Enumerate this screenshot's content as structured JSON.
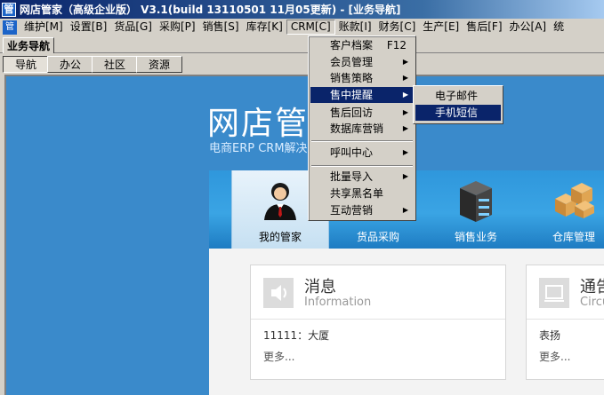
{
  "window": {
    "title": "网店管家（高级企业版） V3.1(build 13110501 11月05更新) - [业务导航]",
    "icon_char": "管"
  },
  "menubar": {
    "icon_char": "管",
    "items": [
      {
        "label": "维护[M]"
      },
      {
        "label": "设置[B]"
      },
      {
        "label": "货品[G]"
      },
      {
        "label": "采购[P]"
      },
      {
        "label": "销售[S]"
      },
      {
        "label": "库存[K]"
      },
      {
        "label": "CRM[C]"
      },
      {
        "label": "账款[I]"
      },
      {
        "label": "财务[C]"
      },
      {
        "label": "生产[E]"
      },
      {
        "label": "售后[F]"
      },
      {
        "label": "办公[A]"
      },
      {
        "label": "统"
      }
    ]
  },
  "doc_tab": {
    "label": "业务导航"
  },
  "sub_tabs": [
    {
      "label": "导航"
    },
    {
      "label": "办公"
    },
    {
      "label": "社区"
    },
    {
      "label": "资源"
    }
  ],
  "brand": {
    "title": "网店管家",
    "subtitle": "电商ERP  CRM解决"
  },
  "toolbar": [
    {
      "label": "我的管家",
      "icon": "manager-icon"
    },
    {
      "label": "货品采购",
      "icon": "purchase-icon"
    },
    {
      "label": "销售业务",
      "icon": "server-icon"
    },
    {
      "label": "仓库管理",
      "icon": "boxes-icon"
    }
  ],
  "cards": [
    {
      "title": "消息",
      "en": "Information",
      "item": "11111：大厦",
      "more": "更多...",
      "icon": "speaker-icon"
    },
    {
      "title": "通告",
      "en": "Circu",
      "item": "表扬",
      "more": "更多...",
      "icon": "notice-icon"
    }
  ],
  "crm_menu": {
    "items": [
      {
        "label": "客户档案",
        "shortcut": "F12"
      },
      {
        "label": "会员管理",
        "submenu": true
      },
      {
        "label": "销售策略",
        "submenu": true
      },
      {
        "label": "售中提醒",
        "submenu": true
      },
      {
        "label": "售后回访",
        "submenu": true
      },
      {
        "label": "数据库营销",
        "submenu": true
      },
      {
        "label": "呼叫中心",
        "submenu": true
      },
      {
        "label": "批量导入",
        "submenu": true
      },
      {
        "label": "共享黑名单"
      },
      {
        "label": "互动营销",
        "submenu": true
      }
    ]
  },
  "submenu": {
    "items": [
      {
        "label": "电子邮件"
      },
      {
        "label": "手机短信"
      }
    ]
  },
  "colors": {
    "menu_highlight": "#0a246a",
    "content_bg": "#3a8acb"
  }
}
